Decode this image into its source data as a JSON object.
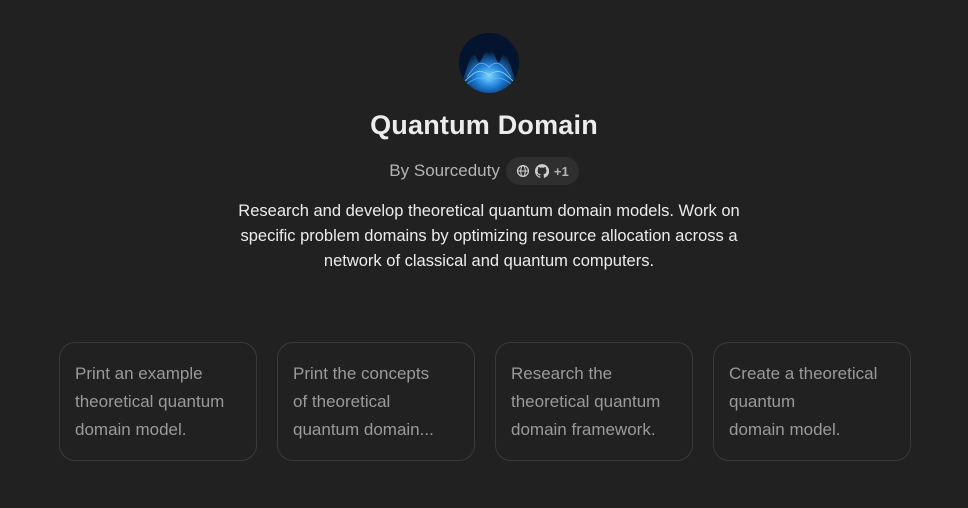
{
  "gpt": {
    "avatar_icon": "quantum-wave-avatar",
    "title": "Quantum Domain",
    "byline": "By Sourceduty",
    "links": {
      "icons": [
        "globe-icon",
        "github-icon"
      ],
      "more": "+1"
    },
    "description": "Research and develop theoretical quantum domain models. Work on specific problem domains by optimizing resource allocation across a network of classical and quantum computers."
  },
  "starters": [
    {
      "lines": [
        "Print an example",
        "theoretical quantum",
        "domain model."
      ]
    },
    {
      "lines": [
        "Print the concepts",
        "of theoretical",
        "quantum domain..."
      ]
    },
    {
      "lines": [
        "Research the",
        "theoretical quantum",
        "domain framework."
      ]
    },
    {
      "lines": [
        "Create a theoretical",
        "quantum",
        "domain model."
      ]
    }
  ],
  "colors": {
    "background": "#212121",
    "card_border": "#3a3a3a",
    "pill": "#2f2f2f",
    "avatar_accent": "#1e88e5"
  }
}
